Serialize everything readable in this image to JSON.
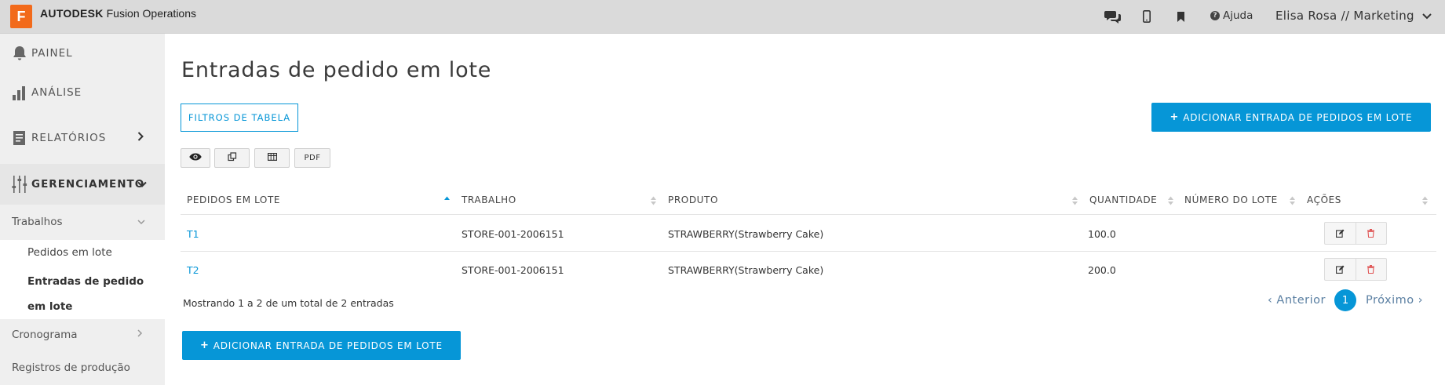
{
  "app": {
    "logo_letter": "F",
    "brand_bold": "AUTODESK",
    "brand_rest": "Fusion Operations",
    "help_label": "Ajuda",
    "user_label": "Elisa Rosa // Marketing",
    "icons": [
      "chat-icon",
      "mobile-icon",
      "bookmark-icon",
      "help-icon",
      "chevron-down-icon"
    ]
  },
  "sidebar": {
    "items": [
      {
        "label": "PAINEL",
        "icon": "bell-icon"
      },
      {
        "label": "ANÁLISE",
        "icon": "bar-chart-icon"
      },
      {
        "label": "RELATÓRIOS",
        "icon": "report-icon",
        "chevron": "›"
      },
      {
        "label": "GERENCIAMENTO",
        "icon": "sliders-icon",
        "chevron": "⌄"
      }
    ],
    "sub": [
      {
        "label": "Trabalhos",
        "chevron": "⌄"
      },
      {
        "label": "Cronograma",
        "chevron": "›"
      },
      {
        "label": "Registros de produção"
      }
    ],
    "subsub": [
      {
        "label": "Pedidos em lote"
      },
      {
        "label": "Entradas de pedido em lote"
      }
    ]
  },
  "main": {
    "title": "Entradas de pedido em lote",
    "filter_button": "FILTROS DE TABELA",
    "add_button": "ADICIONAR ENTRADA DE PEDIDOS EM LOTE",
    "pdf_button": "PDF",
    "columns": [
      "PEDIDOS EM LOTE",
      "TRABALHO",
      "PRODUTO",
      "QUANTIDADE",
      "NÚMERO DO LOTE",
      "AÇÕES"
    ],
    "rows": [
      {
        "pedido": "T1",
        "trabalho": "STORE-001-2006151",
        "produto": "STRAWBERRY(Strawberry Cake)",
        "quantidade": "100.0",
        "lote": ""
      },
      {
        "pedido": "T2",
        "trabalho": "STORE-001-2006151",
        "produto": "STRAWBERRY(Strawberry Cake)",
        "quantidade": "200.0",
        "lote": ""
      }
    ],
    "info": "Mostrando 1 a 2 de um total de 2 entradas",
    "pager": {
      "prev": "‹ Anterior",
      "page": "1",
      "next": "Próximo ›"
    },
    "plus": "+"
  },
  "colors": {
    "accent": "#0696d7",
    "logo": "#f26a1b",
    "topbar": "#dadada",
    "sidebar": "#efefef",
    "delete": "#e05656"
  }
}
